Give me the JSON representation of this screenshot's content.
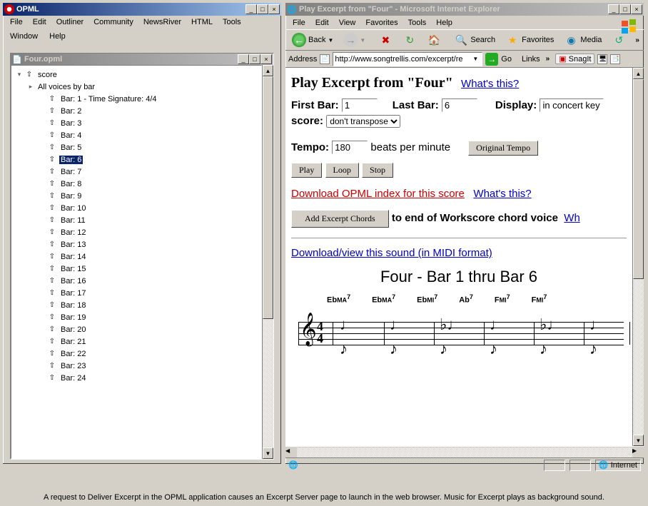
{
  "opml": {
    "app_title": "OPML",
    "menus": [
      "File",
      "Edit",
      "Outliner",
      "Community",
      "NewsRiver",
      "HTML",
      "Tools",
      "Window",
      "Help"
    ],
    "doc_title": "Four.opml",
    "tree": [
      {
        "depth": 0,
        "arrow": "open",
        "label": "score"
      },
      {
        "depth": 1,
        "arrow": "closed",
        "label": "All voices by bar",
        "noicon": true
      },
      {
        "depth": 2,
        "arrow": "none",
        "label": "Bar: 1 - Time Signature: 4/4"
      },
      {
        "depth": 2,
        "arrow": "none",
        "label": "Bar: 2"
      },
      {
        "depth": 2,
        "arrow": "none",
        "label": "Bar: 3"
      },
      {
        "depth": 2,
        "arrow": "none",
        "label": "Bar: 4"
      },
      {
        "depth": 2,
        "arrow": "none",
        "label": "Bar: 5"
      },
      {
        "depth": 2,
        "arrow": "none",
        "label": "Bar: 6",
        "selected": true
      },
      {
        "depth": 2,
        "arrow": "none",
        "label": "Bar: 7"
      },
      {
        "depth": 2,
        "arrow": "none",
        "label": "Bar: 8"
      },
      {
        "depth": 2,
        "arrow": "none",
        "label": "Bar: 9"
      },
      {
        "depth": 2,
        "arrow": "none",
        "label": "Bar: 10"
      },
      {
        "depth": 2,
        "arrow": "none",
        "label": "Bar: 11"
      },
      {
        "depth": 2,
        "arrow": "none",
        "label": "Bar: 12"
      },
      {
        "depth": 2,
        "arrow": "none",
        "label": "Bar: 13"
      },
      {
        "depth": 2,
        "arrow": "none",
        "label": "Bar: 14"
      },
      {
        "depth": 2,
        "arrow": "none",
        "label": "Bar: 15"
      },
      {
        "depth": 2,
        "arrow": "none",
        "label": "Bar: 16"
      },
      {
        "depth": 2,
        "arrow": "none",
        "label": "Bar: 17"
      },
      {
        "depth": 2,
        "arrow": "none",
        "label": "Bar: 18"
      },
      {
        "depth": 2,
        "arrow": "none",
        "label": "Bar: 19"
      },
      {
        "depth": 2,
        "arrow": "none",
        "label": "Bar: 20"
      },
      {
        "depth": 2,
        "arrow": "none",
        "label": "Bar: 21"
      },
      {
        "depth": 2,
        "arrow": "none",
        "label": "Bar: 22"
      },
      {
        "depth": 2,
        "arrow": "none",
        "label": "Bar: 23"
      },
      {
        "depth": 2,
        "arrow": "none",
        "label": "Bar: 24"
      }
    ]
  },
  "ie": {
    "app_title": "Play Excerpt from \"Four\" - Microsoft Internet Explorer",
    "menus": [
      "File",
      "Edit",
      "View",
      "Favorites",
      "Tools",
      "Help"
    ],
    "toolbar": {
      "back": "Back",
      "search": "Search",
      "favorites": "Favorites",
      "media": "Media"
    },
    "addr_label": "Address",
    "url": "http://www.songtrellis.com/excerpt/re",
    "go": "Go",
    "links": "Links",
    "snagit": "SnagIt",
    "status_zone": "Internet"
  },
  "page": {
    "heading": "Play Excerpt from \"Four\"",
    "whats_this": "What's this?",
    "first_bar_label": "First Bar:",
    "first_bar_value": "1",
    "last_bar_label": "Last Bar:",
    "last_bar_value": "6",
    "display_label": "Display:",
    "display_value": "in concert key",
    "score_label": "score:",
    "transpose_value": "don't transpose",
    "tempo_label": "Tempo:",
    "tempo_value": "180",
    "bpm_label": "beats per minute",
    "original_tempo": "Original Tempo",
    "play": "Play",
    "loop": "Loop",
    "stop": "Stop",
    "download_opml": "Download OPML index for this score",
    "add_chords": "Add Excerpt Chords",
    "add_chords_tail": "to end of Workscore chord voice",
    "whats_link_partial": "Wh",
    "download_midi": "Download/view this sound (in MIDI format)",
    "score_title": "Four - Bar 1 thru Bar 6",
    "chords": [
      "EbMA7",
      "EbMA7",
      "EbMI7",
      "Ab7",
      "FMI7",
      "FMI7"
    ]
  },
  "caption": "A request to Deliver Excerpt in the OPML application causes an Excerpt Server page to launch in the web browser. Music for Excerpt plays as background sound."
}
